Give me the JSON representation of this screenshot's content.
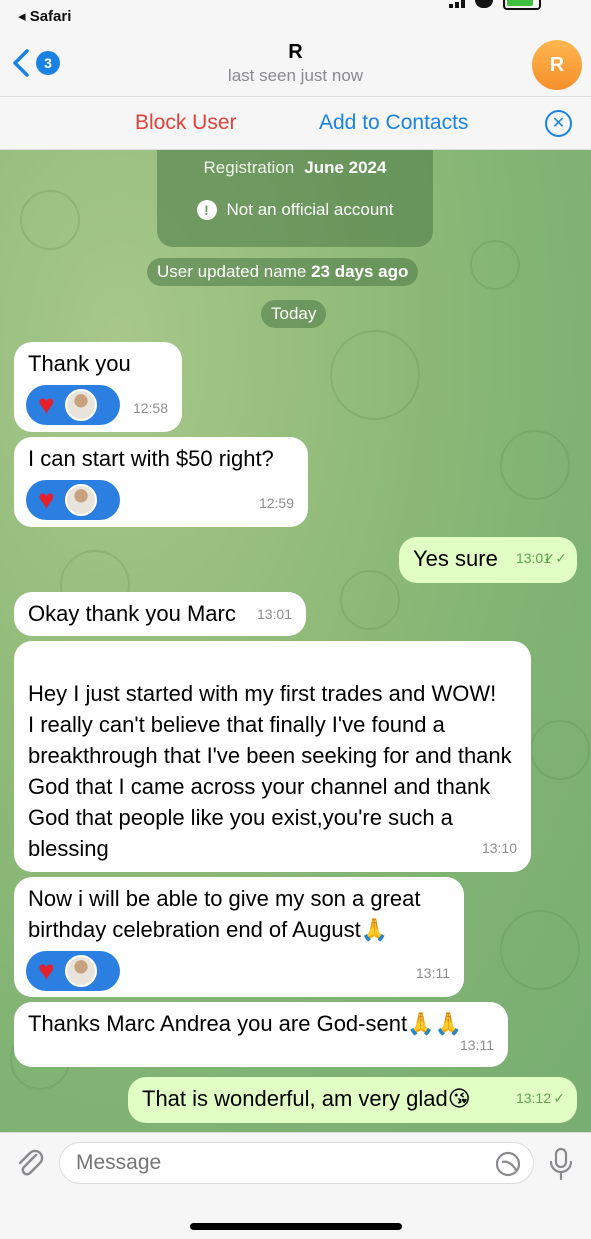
{
  "status": {
    "back_app": "◂ Safari"
  },
  "header": {
    "back_badge": "3",
    "title": "R",
    "subtitle": "last seen just now",
    "avatar_letter": "R"
  },
  "actions": {
    "block": "Block User",
    "add": "Add to Contacts"
  },
  "info": {
    "registration_label": "Registration",
    "registration_value": "June 2024",
    "official": "Not an official account"
  },
  "system": {
    "updated_prefix": "User updated name",
    "updated_when": "23 days ago",
    "date_divider": "Today"
  },
  "messages": [
    {
      "text": "Thank you",
      "time": "12:58"
    },
    {
      "text": "I can start with $50 right?",
      "time": "12:59"
    },
    {
      "text": "Yes sure",
      "time": "13:01"
    },
    {
      "text": "Okay thank you Marc",
      "time": "13:01"
    },
    {
      "text": "Hey I just started with my first trades and WOW!\nI really can't believe that finally I've found a breakthrough that I've been seeking for and thank God that I came across your channel and thank God that people like you exist,you're such a blessing",
      "time": "13:10"
    },
    {
      "text": "Now i will be able to give my son a great birthday celebration end of August🙏",
      "time": "13:11"
    },
    {
      "text": "Thanks Marc Andrea you are God-sent🙏🙏",
      "time": "13:11"
    },
    {
      "text": "That is wonderful, am very glad😘",
      "time": "13:12"
    }
  ],
  "input": {
    "placeholder": "Message"
  },
  "colors": {
    "accent": "#1a82e2",
    "danger": "#e0413a",
    "outgoing": "#e1fec5",
    "avatar": "#f5902a"
  }
}
